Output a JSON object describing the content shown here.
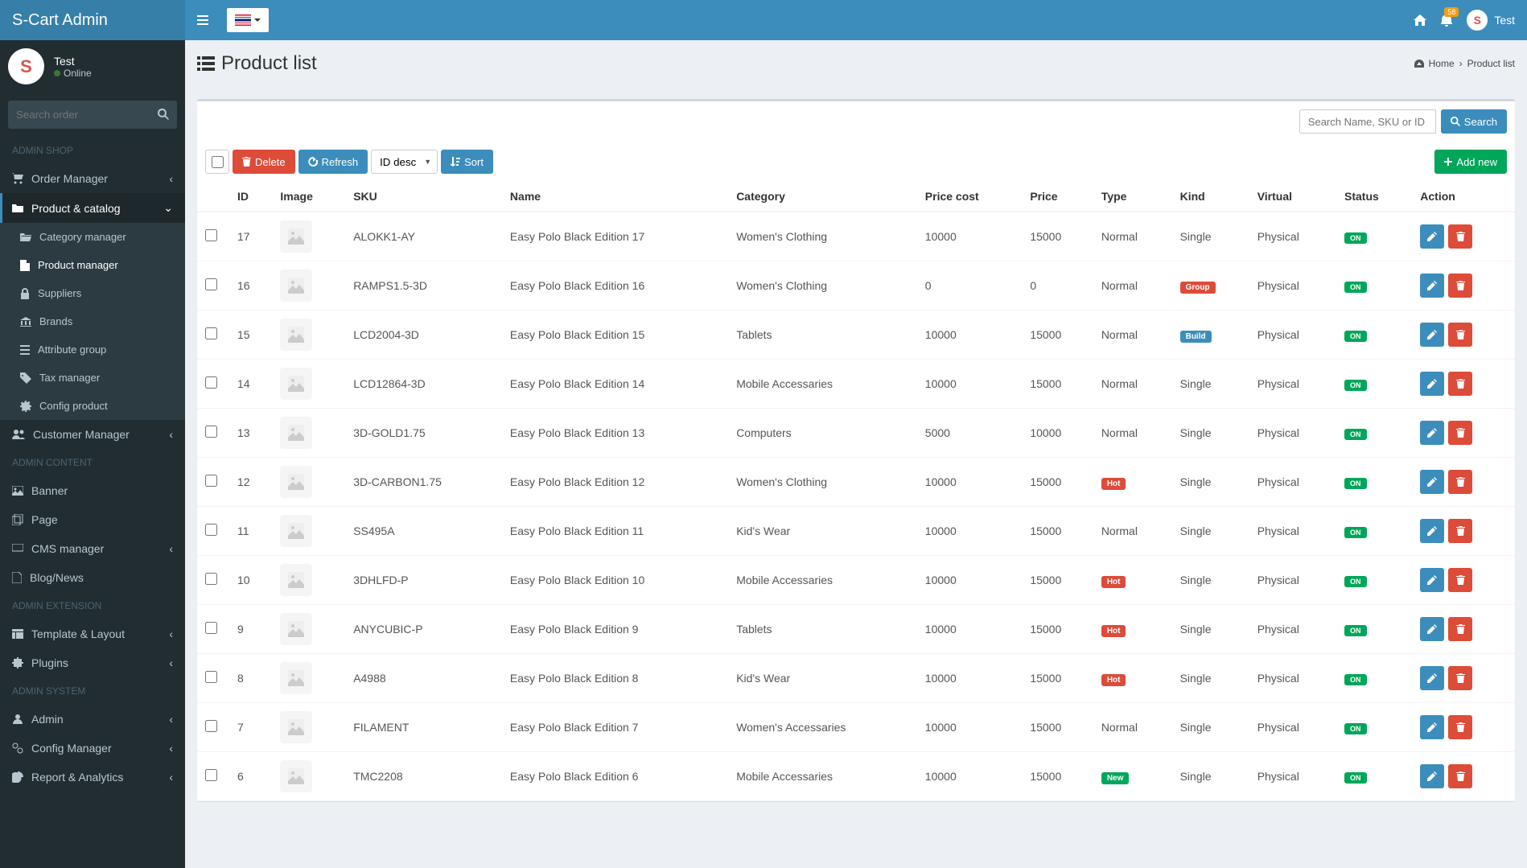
{
  "app_title": "S-Cart Admin",
  "top_user": "Test",
  "notif_count": "58",
  "sidebar": {
    "user_name": "Test",
    "user_status": "Online",
    "search_placeholder": "Search order",
    "headers": {
      "shop": "ADMIN SHOP",
      "content": "ADMIN CONTENT",
      "extension": "ADMIN EXTENSION",
      "system": "ADMIN SYSTEM"
    },
    "items": {
      "order_mgr": "Order Manager",
      "product_catalog": "Product & catalog",
      "category_mgr": "Category manager",
      "product_mgr": "Product manager",
      "suppliers": "Suppliers",
      "brands": "Brands",
      "attribute_group": "Attribute group",
      "tax_mgr": "Tax manager",
      "config_product": "Config product",
      "customer_mgr": "Customer Manager",
      "banner": "Banner",
      "page": "Page",
      "cms_mgr": "CMS manager",
      "blog": "Blog/News",
      "template": "Template & Layout",
      "plugins": "Plugins",
      "admin": "Admin",
      "config_mgr": "Config Manager",
      "report": "Report & Analytics"
    }
  },
  "page_title": "Product list",
  "breadcrumb": {
    "home": "Home",
    "current": "Product list"
  },
  "search": {
    "placeholder": "Search Name, SKU or ID",
    "button": "Search"
  },
  "toolbar": {
    "delete": "Delete",
    "refresh": "Refresh",
    "sort_option": "ID desc",
    "sort_btn": "Sort",
    "add_new": "Add new"
  },
  "th": {
    "id": "ID",
    "image": "Image",
    "sku": "SKU",
    "name": "Name",
    "category": "Category",
    "price_cost": "Price cost",
    "price": "Price",
    "type": "Type",
    "kind": "Kind",
    "virtual": "Virtual",
    "status": "Status",
    "action": "Action"
  },
  "status_on": "ON",
  "kinds": {
    "single": "Single",
    "group": "Group",
    "build": "Build"
  },
  "types": {
    "normal": "Normal",
    "hot": "Hot",
    "new": "New"
  },
  "rows": [
    {
      "id": "17",
      "sku": "ALOKK1-AY",
      "name": "Easy Polo Black Edition 17",
      "category": "Women's Clothing",
      "price_cost": "10000",
      "price": "15000",
      "type": "Normal",
      "type_cls": "",
      "kind": "Single",
      "kind_cls": "",
      "virtual": "Physical"
    },
    {
      "id": "16",
      "sku": "RAMPS1.5-3D",
      "name": "Easy Polo Black Edition 16",
      "category": "Women's Clothing",
      "price_cost": "0",
      "price": "0",
      "type": "Normal",
      "type_cls": "",
      "kind": "Group",
      "kind_cls": "badge-group",
      "virtual": "Physical"
    },
    {
      "id": "15",
      "sku": "LCD2004-3D",
      "name": "Easy Polo Black Edition 15",
      "category": "Tablets",
      "price_cost": "10000",
      "price": "15000",
      "type": "Normal",
      "type_cls": "",
      "kind": "Build",
      "kind_cls": "badge-build",
      "virtual": "Physical"
    },
    {
      "id": "14",
      "sku": "LCD12864-3D",
      "name": "Easy Polo Black Edition 14",
      "category": "Mobile Accessaries",
      "price_cost": "10000",
      "price": "15000",
      "type": "Normal",
      "type_cls": "",
      "kind": "Single",
      "kind_cls": "",
      "virtual": "Physical"
    },
    {
      "id": "13",
      "sku": "3D-GOLD1.75",
      "name": "Easy Polo Black Edition 13",
      "category": "Computers",
      "price_cost": "5000",
      "price": "10000",
      "type": "Normal",
      "type_cls": "",
      "kind": "Single",
      "kind_cls": "",
      "virtual": "Physical"
    },
    {
      "id": "12",
      "sku": "3D-CARBON1.75",
      "name": "Easy Polo Black Edition 12",
      "category": "Women's Clothing",
      "price_cost": "10000",
      "price": "15000",
      "type": "Hot",
      "type_cls": "badge-hot",
      "kind": "Single",
      "kind_cls": "",
      "virtual": "Physical"
    },
    {
      "id": "11",
      "sku": "SS495A",
      "name": "Easy Polo Black Edition 11",
      "category": "Kid's Wear",
      "price_cost": "10000",
      "price": "15000",
      "type": "Normal",
      "type_cls": "",
      "kind": "Single",
      "kind_cls": "",
      "virtual": "Physical"
    },
    {
      "id": "10",
      "sku": "3DHLFD-P",
      "name": "Easy Polo Black Edition 10",
      "category": "Mobile Accessaries",
      "price_cost": "10000",
      "price": "15000",
      "type": "Hot",
      "type_cls": "badge-hot",
      "kind": "Single",
      "kind_cls": "",
      "virtual": "Physical"
    },
    {
      "id": "9",
      "sku": "ANYCUBIC-P",
      "name": "Easy Polo Black Edition 9",
      "category": "Tablets",
      "price_cost": "10000",
      "price": "15000",
      "type": "Hot",
      "type_cls": "badge-hot",
      "kind": "Single",
      "kind_cls": "",
      "virtual": "Physical"
    },
    {
      "id": "8",
      "sku": "A4988",
      "name": "Easy Polo Black Edition 8",
      "category": "Kid's Wear",
      "price_cost": "10000",
      "price": "15000",
      "type": "Hot",
      "type_cls": "badge-hot",
      "kind": "Single",
      "kind_cls": "",
      "virtual": "Physical"
    },
    {
      "id": "7",
      "sku": "FILAMENT",
      "name": "Easy Polo Black Edition 7",
      "category": "Women's Accessaries",
      "price_cost": "10000",
      "price": "15000",
      "type": "Normal",
      "type_cls": "",
      "kind": "Single",
      "kind_cls": "",
      "virtual": "Physical"
    },
    {
      "id": "6",
      "sku": "TMC2208",
      "name": "Easy Polo Black Edition 6",
      "category": "Mobile Accessaries",
      "price_cost": "10000",
      "price": "15000",
      "type": "New",
      "type_cls": "badge-new",
      "kind": "Single",
      "kind_cls": "",
      "virtual": "Physical"
    }
  ]
}
